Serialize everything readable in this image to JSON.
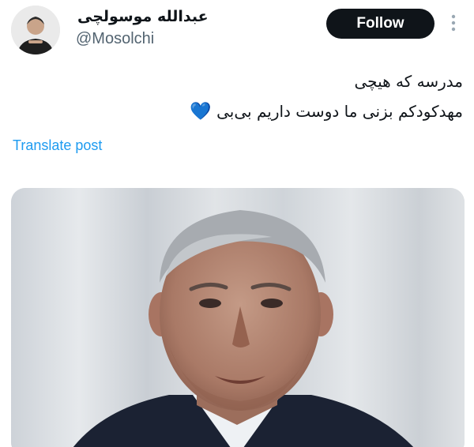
{
  "author": {
    "display_name": "عبدالله موسولچی",
    "handle": "@Mosolchi",
    "avatar_icon": "avatar-icon"
  },
  "actions": {
    "follow_label": "Follow",
    "more_icon": "more-icon"
  },
  "tweet": {
    "lines": [
      "مدرسه که هیچی",
      "مهدکودکم بزنی ما دوست داریم بی‌بی"
    ],
    "emoji": "💙",
    "translate_label": "Translate post"
  },
  "colors": {
    "follow_button_bg": "#0f1419",
    "link": "#1d9bf0",
    "handle": "#536471",
    "heart": "#4aa6e8"
  }
}
